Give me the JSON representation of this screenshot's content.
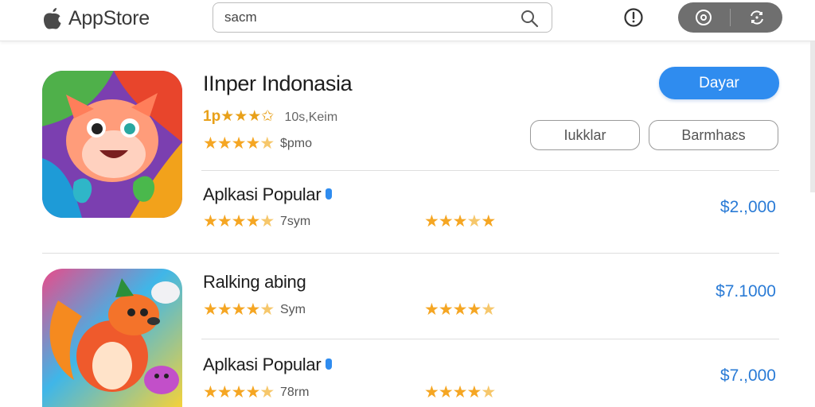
{
  "header": {
    "brand": "AppStore",
    "search_value": "sacm"
  },
  "featured": {
    "title": "IInper Indonasia",
    "rating_text": "1p★★★✩",
    "rating_count": "10s,Keim",
    "stars_count": "$pmo",
    "primary_button": "Dayar",
    "button_a": "Iukklar",
    "button_b": "Barmhaɛs"
  },
  "rows": [
    {
      "title": "Aplkasi Popular",
      "count": "7sym",
      "price": "$2.,000"
    },
    {
      "title": "Ralking abing",
      "count": "Sym",
      "price": "$7.1000"
    },
    {
      "title": "Aplkasi Popular",
      "count": "78rm",
      "price": "$7.,000"
    }
  ],
  "icons": [
    "apple-logo-icon",
    "search-icon",
    "info-icon",
    "record-icon",
    "camera-switch-icon"
  ],
  "colors": {
    "accent": "#2f8cef",
    "star": "#f5a623",
    "price": "#2a7bd6"
  }
}
